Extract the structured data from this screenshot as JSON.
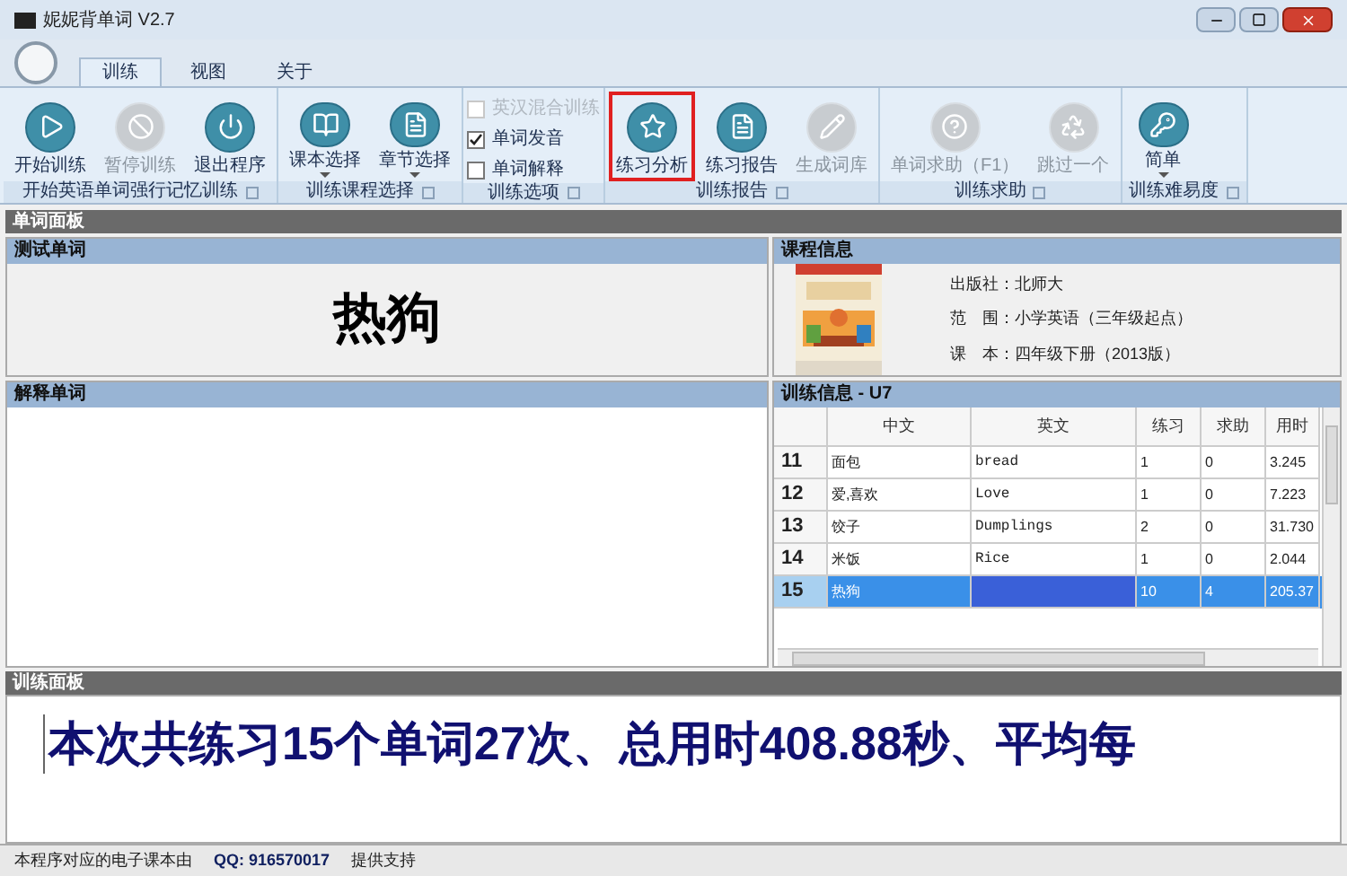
{
  "window": {
    "title": "妮妮背单词 V2.7"
  },
  "tabs": [
    {
      "label": "训练",
      "selected": true
    },
    {
      "label": "视图",
      "selected": false
    },
    {
      "label": "关于",
      "selected": false
    }
  ],
  "ribbon": [
    {
      "kind": "buttons",
      "caption": "开始英语单词强行记忆训练",
      "items": [
        {
          "label": "开始训练",
          "disabled": false,
          "highlighted": false,
          "dropdown": false
        },
        {
          "label": "暂停训练",
          "disabled": true,
          "highlighted": false,
          "dropdown": false
        },
        {
          "label": "退出程序",
          "disabled": false,
          "highlighted": false,
          "dropdown": false
        }
      ]
    },
    {
      "kind": "buttons",
      "caption": "训练课程选择",
      "items": [
        {
          "label": "课本选择",
          "disabled": false,
          "highlighted": false,
          "dropdown": true
        },
        {
          "label": "章节选择",
          "disabled": false,
          "highlighted": false,
          "dropdown": true
        }
      ]
    },
    {
      "kind": "checks",
      "caption": "训练选项",
      "items": [
        {
          "label": "英汉混合训练",
          "checked": false,
          "disabled": true
        },
        {
          "label": "单词发音",
          "checked": true,
          "disabled": false
        },
        {
          "label": "单词解释",
          "checked": false,
          "disabled": false
        }
      ]
    },
    {
      "kind": "buttons",
      "caption": "训练报告",
      "items": [
        {
          "label": "练习分析",
          "disabled": false,
          "highlighted": true,
          "dropdown": false
        },
        {
          "label": "练习报告",
          "disabled": false,
          "highlighted": false,
          "dropdown": false
        },
        {
          "label": "生成词库",
          "disabled": true,
          "highlighted": false,
          "dropdown": false
        }
      ]
    },
    {
      "kind": "buttons",
      "caption": "训练求助",
      "items": [
        {
          "label": "单词求助（F1）",
          "disabled": true,
          "highlighted": false,
          "dropdown": false
        },
        {
          "label": "跳过一个",
          "disabled": true,
          "highlighted": false,
          "dropdown": false
        }
      ]
    },
    {
      "kind": "buttons",
      "caption": "训练难易度",
      "items": [
        {
          "label": "简单",
          "disabled": false,
          "highlighted": false,
          "dropdown": true
        }
      ]
    }
  ],
  "word_panel": {
    "title": "单词面板",
    "test_word": {
      "title": "测试单词",
      "word": "热狗"
    },
    "explain_word": {
      "title": "解释单词"
    }
  },
  "course_info": {
    "title": "课程信息",
    "lines": [
      {
        "label": "出版社：",
        "value": "北师大"
      },
      {
        "label": "范　围：",
        "value": "小学英语（三年级起点）"
      },
      {
        "label": "课　本：",
        "value": "四年级下册（2013版）"
      }
    ]
  },
  "training_info": {
    "title": "训练信息 - U7",
    "columns": [
      "中文",
      "英文",
      "练习",
      "求助",
      "用时"
    ],
    "rows": [
      {
        "index": "11",
        "cells": [
          "面包",
          "bread",
          "1",
          "0",
          "3.245"
        ],
        "selected": false
      },
      {
        "index": "12",
        "cells": [
          "爱,喜欢",
          "Love",
          "1",
          "0",
          "7.223"
        ],
        "selected": false
      },
      {
        "index": "13",
        "cells": [
          "饺子",
          "Dumplings",
          "2",
          "0",
          "31.730"
        ],
        "selected": false
      },
      {
        "index": "14",
        "cells": [
          "米饭",
          "Rice",
          "1",
          "0",
          "2.044"
        ],
        "selected": false
      },
      {
        "index": "15",
        "cells": [
          "热狗",
          "",
          "10",
          "4",
          "205.37"
        ],
        "selected": true
      }
    ]
  },
  "training_panel": {
    "title": "训练面板",
    "summary": "本次共练习15个单词27次、总用时408.88秒、平均每"
  },
  "status_bar": {
    "text": "本程序对应的电子课本由",
    "qq": "QQ: 916570017",
    "support": "提供支持"
  }
}
